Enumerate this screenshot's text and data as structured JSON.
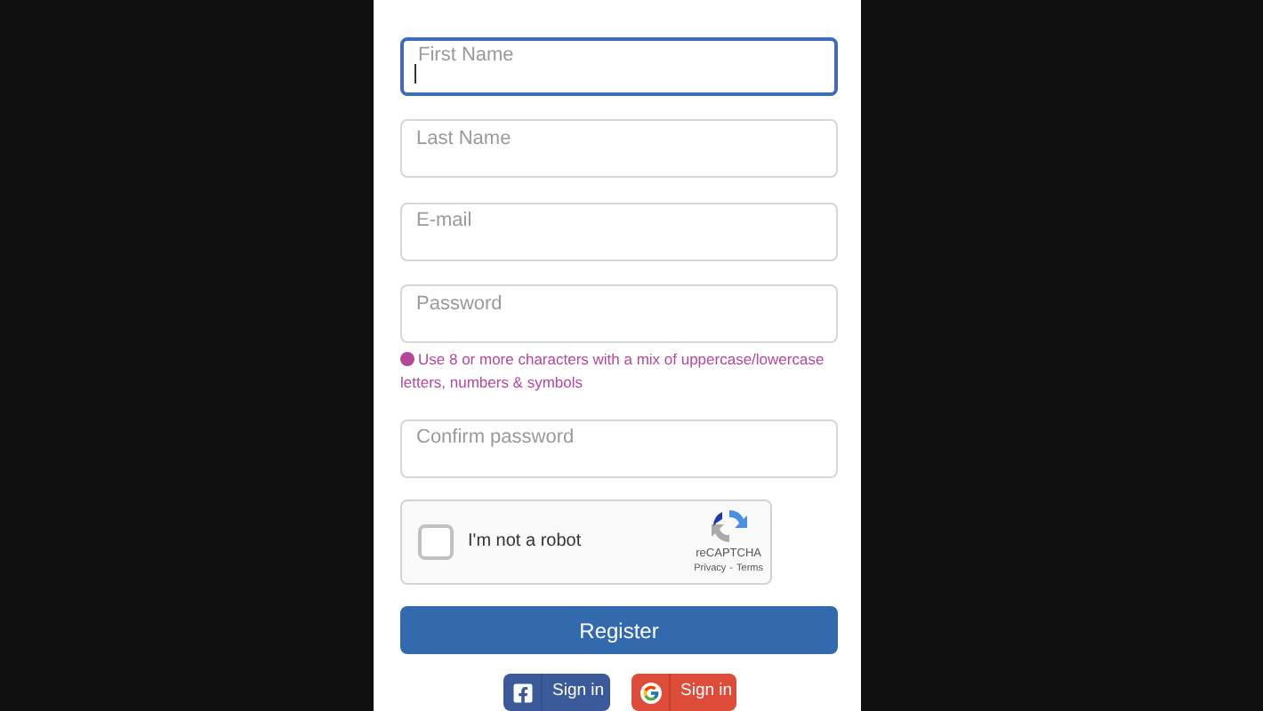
{
  "fields": [
    {
      "placeholder": "First Name",
      "focused": true
    },
    {
      "placeholder": "Last Name",
      "focused": false
    },
    {
      "placeholder": "E-mail",
      "focused": false
    },
    {
      "placeholder": "Password",
      "focused": false,
      "hint": "Use 8 or more characters with a mix of uppercase/lowercase letters, numbers & symbols"
    },
    {
      "placeholder": "Confirm password",
      "focused": false
    }
  ],
  "captcha": {
    "label": "I'm not a robot",
    "checked": false,
    "brand": "reCAPTCHA",
    "privacy": "Privacy",
    "separator": "-",
    "terms": "Terms"
  },
  "register": "Register",
  "social": [
    {
      "kind": "facebook",
      "label": "Sign in"
    },
    {
      "kind": "google",
      "label": "Sign in"
    }
  ]
}
